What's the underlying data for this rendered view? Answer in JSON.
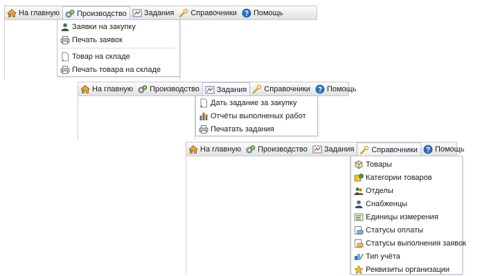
{
  "menu": {
    "home": "На главную",
    "production": "Производство",
    "tasks": "Задания",
    "directories": "Справочники",
    "help": "Помощь"
  },
  "production_menu": {
    "items": [
      "Заявки на закупку",
      "Печать заявок",
      "Товар на складе",
      "Печать товара на складе"
    ]
  },
  "tasks_menu": {
    "items": [
      "Дать задание за закупку",
      "Отчёты выполненых работ",
      "Печатать задания"
    ]
  },
  "directories_menu": {
    "items": [
      "Товары",
      "Категории товаров",
      "Отделы",
      "Снабженцы",
      "Единицы измерения",
      "Статусы оплаты",
      "Статусы выполнения заявок",
      "Тип учёта",
      "Реквизиты организации"
    ]
  },
  "colors": {
    "menubar_top": "#fbfbfb",
    "menubar_bottom": "#e2e2e2",
    "dropdown_border": "#b9c3cf",
    "home_icon": "#d9822b",
    "help_icon": "#2c6fc7"
  }
}
